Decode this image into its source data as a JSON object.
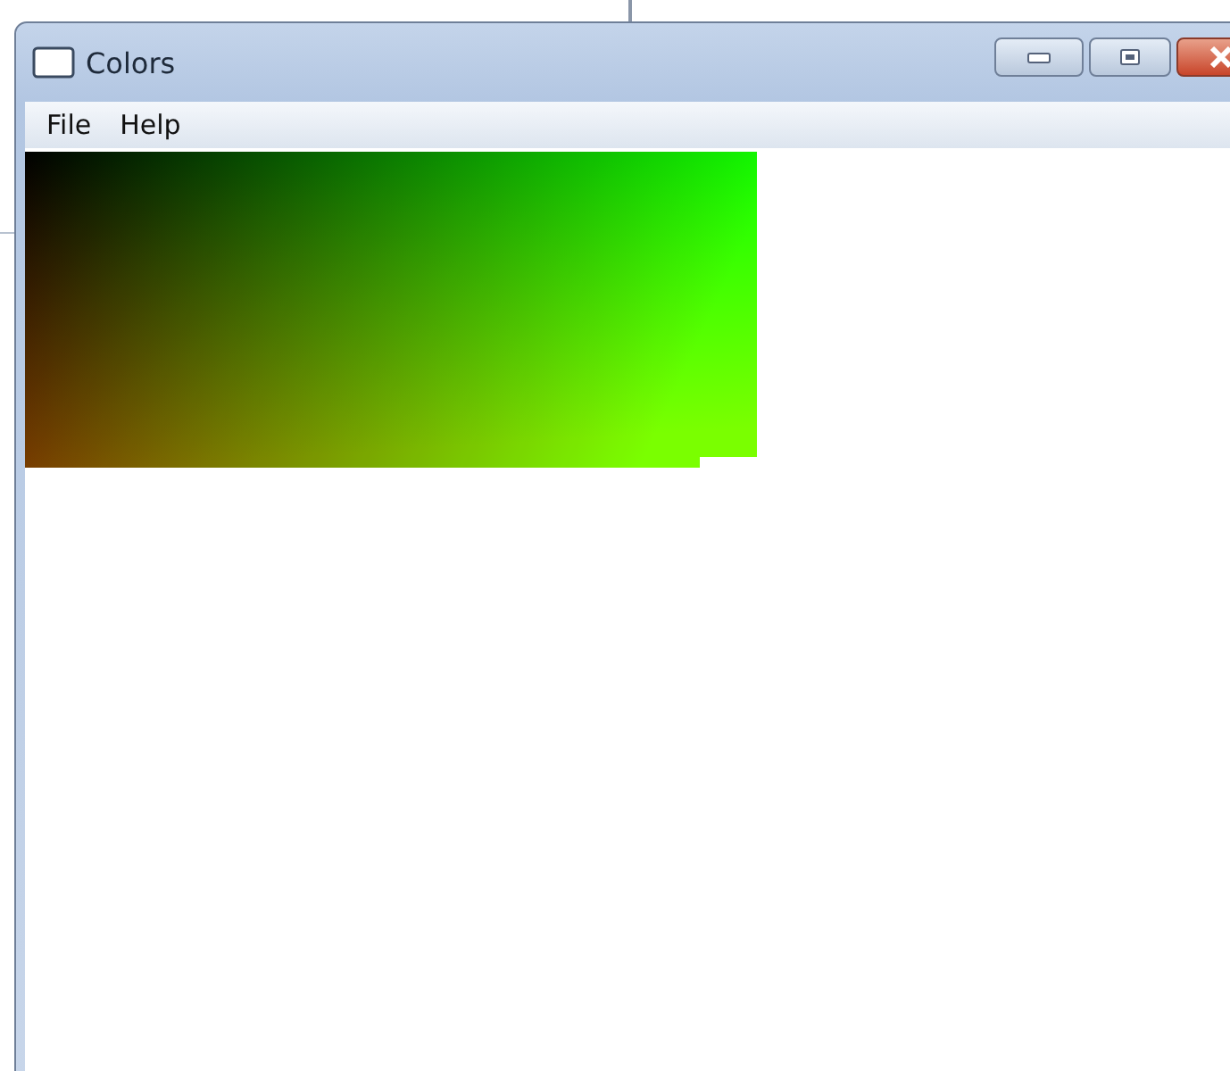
{
  "window": {
    "title": "Colors"
  },
  "menu": [
    {
      "label": "File"
    },
    {
      "label": "Help"
    }
  ]
}
